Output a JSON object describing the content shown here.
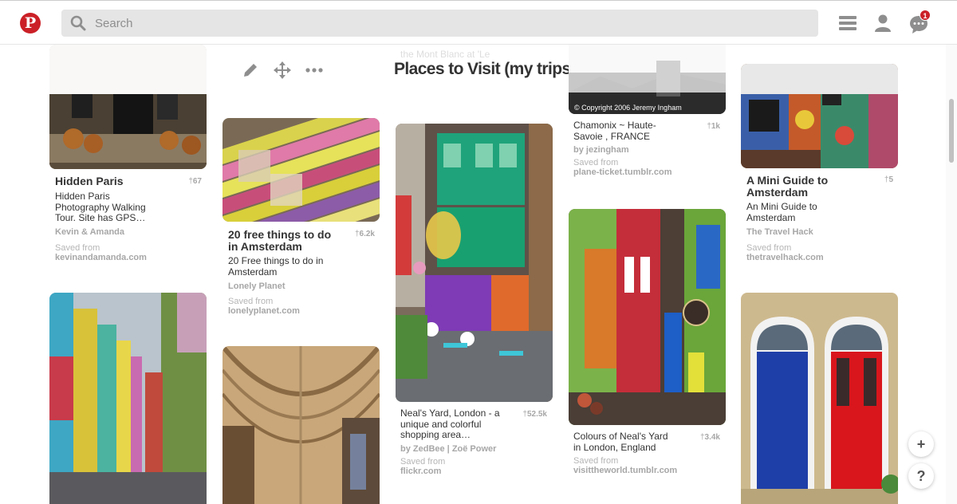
{
  "header": {
    "logo": "P",
    "search_placeholder": "Search",
    "notification_count": "1"
  },
  "board": {
    "title": "Places to Visit (my trips)"
  },
  "faded_text": {
    "col3": "the Mont Blanc at 'Le"
  },
  "pins": [
    {
      "title": "Hidden Paris",
      "count": "67",
      "desc": "Hidden Paris Photography Walking Tour. Site has GPS…",
      "author": "Kevin & Amanda",
      "saved_label": "Saved from",
      "source": "kevinandamanda.com"
    },
    {
      "title": "20 free things to do in Amsterdam",
      "count": "6.2k",
      "desc": "20 Free things to do in Amsterdam",
      "author": "Lonely Planet",
      "saved_label": "Saved from",
      "source": "lonelyplanet.com"
    },
    {
      "title": "",
      "count": "52.5k",
      "desc": "Neal's Yard, London - a unique and colorful shopping area…",
      "author": "by ZedBee | Zoë Power",
      "saved_label": "Saved from",
      "source": "flickr.com"
    },
    {
      "title": "",
      "count": "1k",
      "desc": "Chamonix ~ Haute-Savoie , FRANCE",
      "author": "by jezingham",
      "saved_label": "Saved from",
      "source": "plane-ticket.tumblr.com",
      "image_caption": "© Copyright 2006 Jeremy Ingham"
    },
    {
      "title": "",
      "count": "3.4k",
      "desc": "Colours of Neal's Yard in London, England",
      "author": "",
      "saved_label": "Saved from",
      "source": "visittheworld.tumblr.com"
    },
    {
      "title": "A Mini Guide to Amsterdam",
      "count": "5",
      "desc": "An Mini Guide to Amsterdam",
      "author": "The Travel Hack",
      "saved_label": "Saved from",
      "source": "thetravelhack.com"
    }
  ],
  "fab": {
    "add": "+",
    "help": "?"
  },
  "colors": {
    "brand": "#cb2027",
    "search_bg": "#e5e5e5"
  }
}
